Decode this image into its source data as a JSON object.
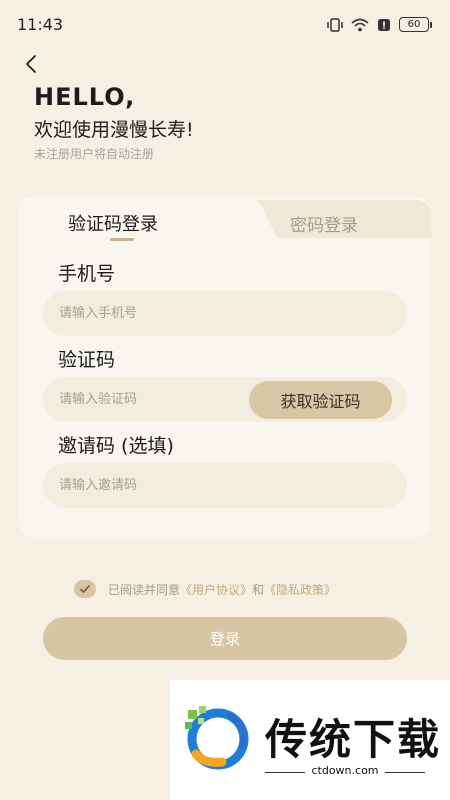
{
  "status_bar": {
    "time": "11:43",
    "battery": "60"
  },
  "header": {
    "greeting": "HELLO,",
    "welcome": "欢迎使用漫慢长寿!",
    "subtitle": "未注册用户将自动注册"
  },
  "tabs": [
    {
      "label": "验证码登录",
      "active": true
    },
    {
      "label": "密码登录",
      "active": false
    }
  ],
  "form": {
    "phone_label": "手机号",
    "phone_placeholder": "请输入手机号",
    "code_label": "验证码",
    "code_placeholder": "请输入验证码",
    "get_code_button": "获取验证码",
    "invite_label": "邀请码 (选填)",
    "invite_placeholder": "请输入邀请码"
  },
  "agreement": {
    "prefix": "已阅读并同意",
    "user_agreement": "《用户协议》",
    "connector": "和",
    "privacy_policy": "《隐私政策》",
    "checked": true
  },
  "login_button": "登录",
  "ad": {
    "title": "传统下载",
    "url": "ctdown.com"
  },
  "colors": {
    "background": "#f5f0e3",
    "accent": "#d6c6a3",
    "link": "#c4a87a"
  }
}
